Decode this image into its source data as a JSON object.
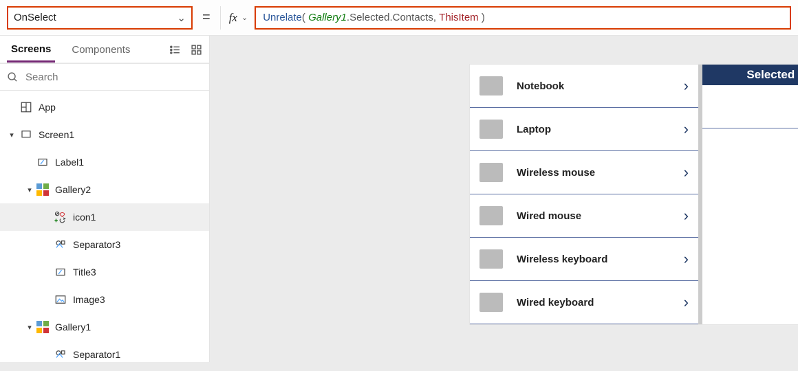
{
  "formula": {
    "property": "OnSelect",
    "code": {
      "func": "Unrelate",
      "arg1_ident": "Gallery1",
      "arg1_chain": ".Selected.Contacts",
      "sep": ", ",
      "arg2": "ThisItem"
    }
  },
  "left": {
    "tabs": {
      "screens": "Screens",
      "components": "Components"
    },
    "search_placeholder": "Search",
    "tree": {
      "app": "App",
      "screen1": "Screen1",
      "label1": "Label1",
      "gallery2": "Gallery2",
      "icon1": "icon1",
      "separator3": "Separator3",
      "title3": "Title3",
      "image3": "Image3",
      "gallery1": "Gallery1",
      "separator1": "Separator1"
    }
  },
  "canvas": {
    "contacts_header": "Selected Product Contacts",
    "products": [
      "Notebook",
      "Laptop",
      "Wireless mouse",
      "Wired mouse",
      "Wireless keyboard",
      "Wired keyboard"
    ]
  }
}
